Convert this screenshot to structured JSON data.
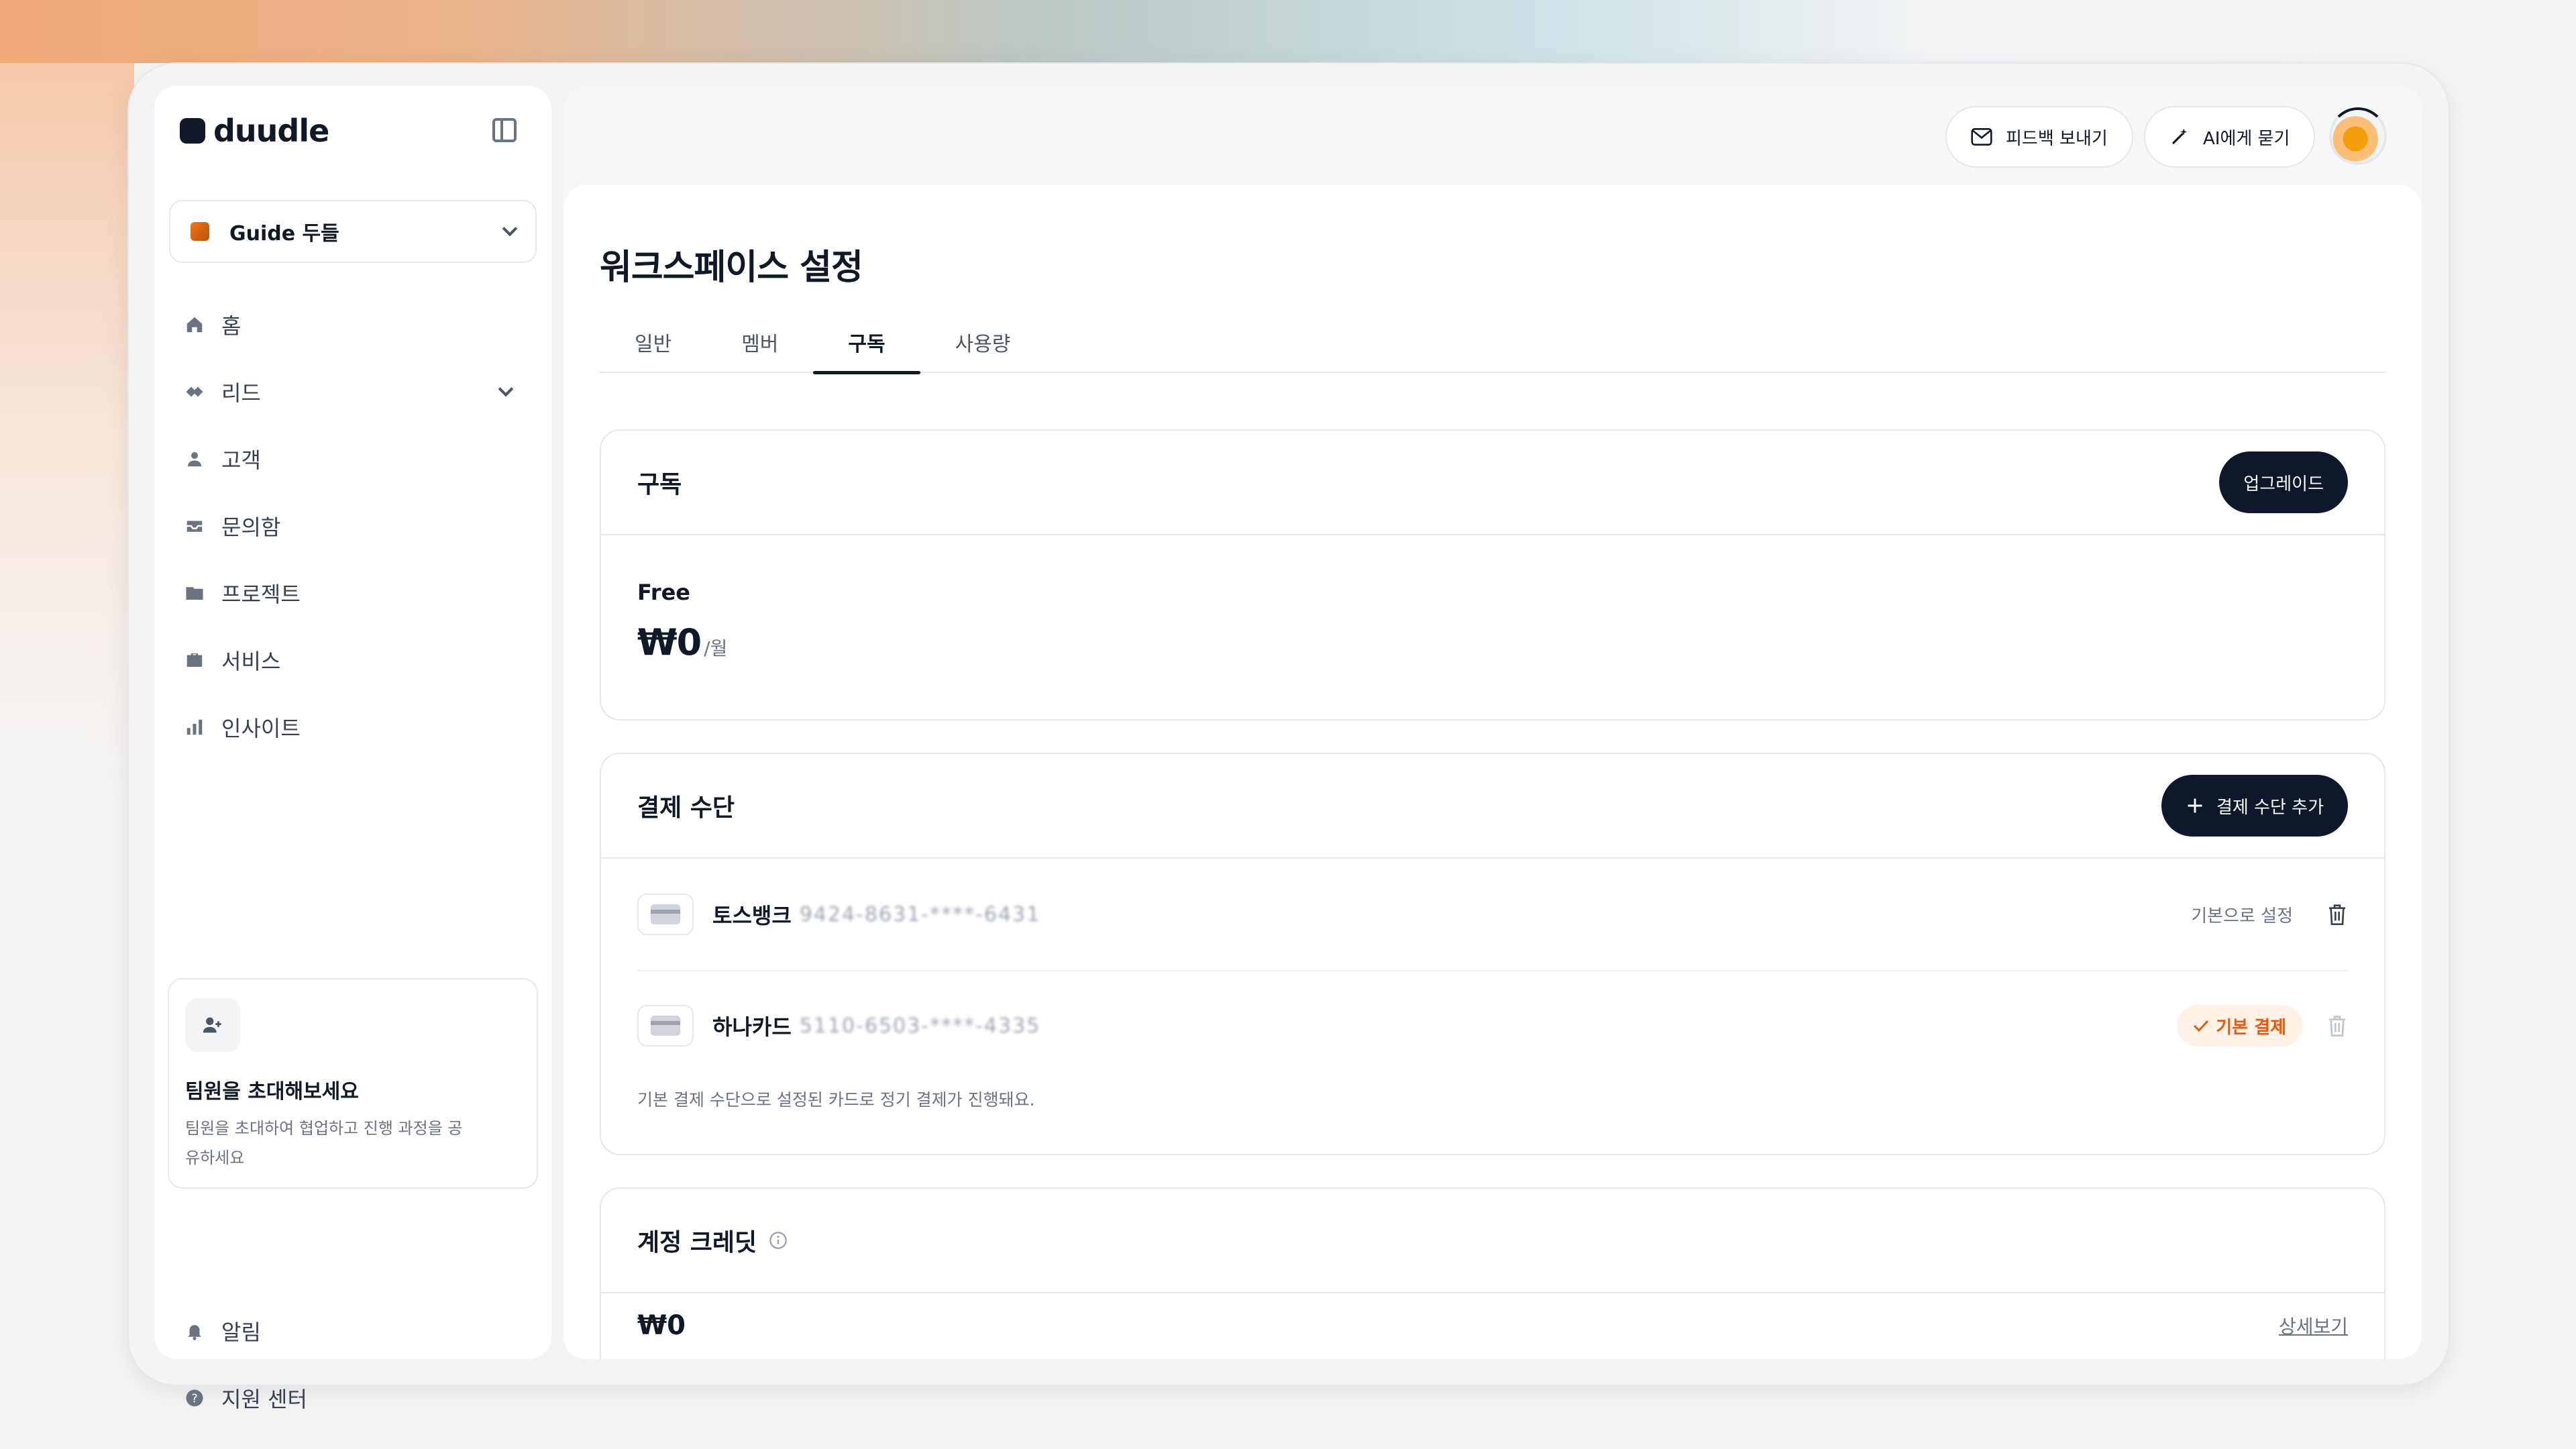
{
  "app": {
    "logo_text": "duudle"
  },
  "sidebar": {
    "workspace": "Guide 두들",
    "items": [
      {
        "label": "홈",
        "icon": "home-icon"
      },
      {
        "label": "리드",
        "icon": "leads-icon",
        "expandable": true
      },
      {
        "label": "고객",
        "icon": "user-icon"
      },
      {
        "label": "문의함",
        "icon": "inbox-icon"
      },
      {
        "label": "프로젝트",
        "icon": "folder-icon"
      },
      {
        "label": "서비스",
        "icon": "briefcase-icon"
      },
      {
        "label": "인사이트",
        "icon": "bar-chart-icon"
      }
    ],
    "invite": {
      "title": "팀원을 초대해보세요",
      "desc": "팀원을 초대하여 협업하고 진행 과정을 공유하세요"
    },
    "bottom_items": [
      {
        "label": "알림",
        "icon": "bell-icon"
      },
      {
        "label": "지원 센터",
        "icon": "help-icon"
      }
    ]
  },
  "header": {
    "feedback_label": "피드백 보내기",
    "ask_ai_label": "AI에게 묻기"
  },
  "main": {
    "title": "워크스페이스 설정",
    "tabs": [
      "일반",
      "멤버",
      "구독",
      "사용량"
    ],
    "active_tab": "구독",
    "subscription": {
      "title": "구독",
      "upgrade_label": "업그레이드",
      "plan_name": "Free",
      "price": "₩0",
      "period": "/월"
    },
    "payment": {
      "title": "결제 수단",
      "add_label": "결제 수단 추가",
      "methods": [
        {
          "bank": "토스뱅크",
          "number": "9424-8631-****-6431",
          "action": "기본으로 설정"
        },
        {
          "bank": "하나카드",
          "number": "5110-6503-****-4335",
          "badge": "기본 결제"
        }
      ],
      "note": "기본 결제 수단으로 설정된 카드로 정기 결제가 진행돼요."
    },
    "credit": {
      "title": "계정 크레딧",
      "amount": "₩0",
      "detail_label": "상세보기"
    }
  },
  "colors": {
    "accent_dark": "#0f172a",
    "badge_orange": "#ea580c",
    "badge_bg": "#fff1e6"
  }
}
